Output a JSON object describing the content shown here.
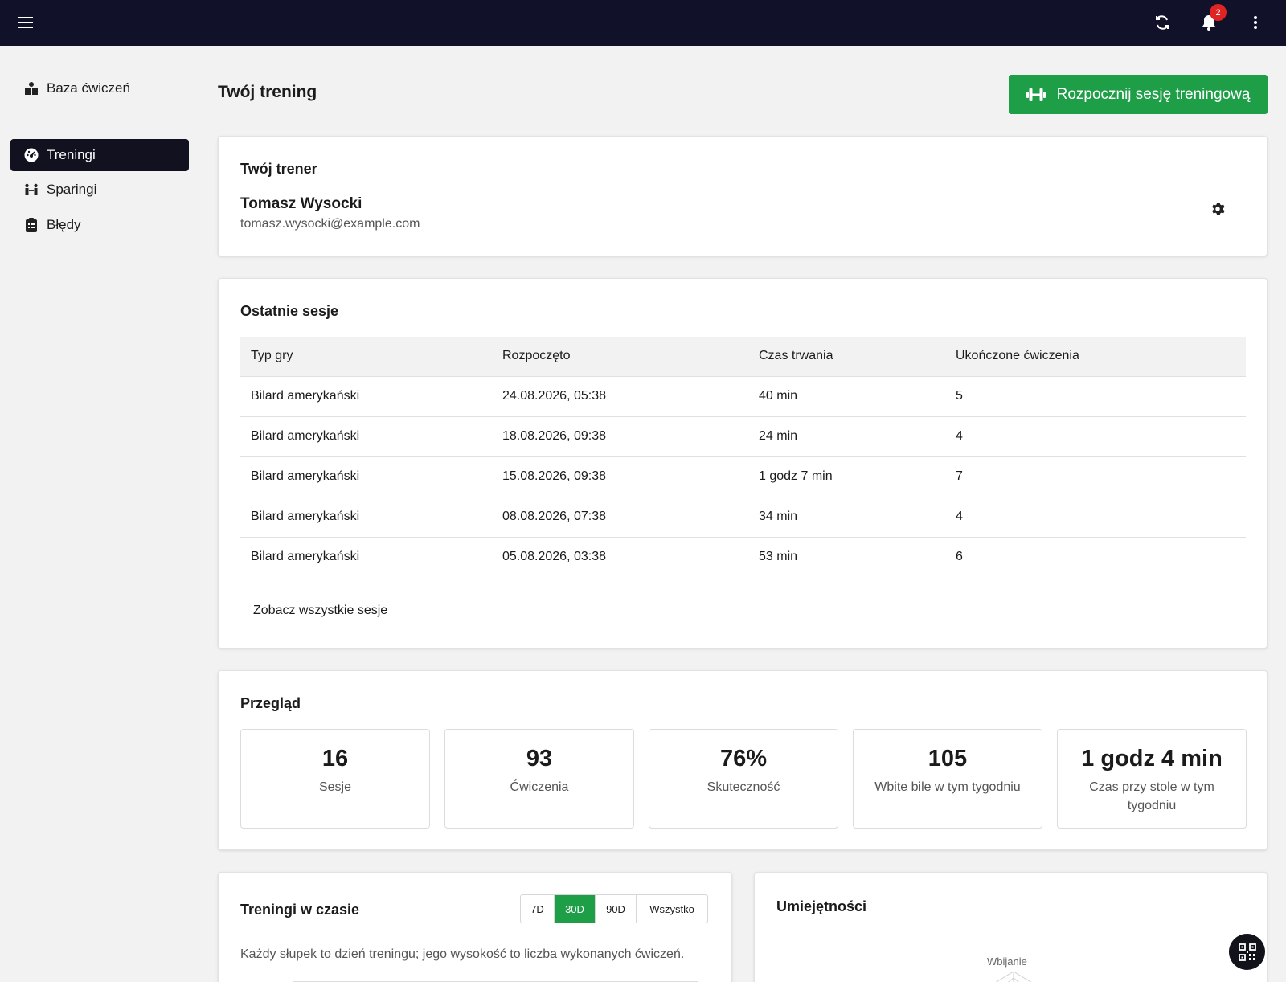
{
  "topbar": {
    "notifications_count": "2",
    "icons": [
      "menu-icon",
      "refresh-icon",
      "bell-icon",
      "more-vertical-icon"
    ]
  },
  "sidebar": {
    "items": [
      {
        "label": "Baza ćwiczeń",
        "icon": "library-icon",
        "active": false
      },
      {
        "label": "Treningi",
        "icon": "dashboard-icon",
        "active": true
      },
      {
        "label": "Sparingi",
        "icon": "sparring-icon",
        "active": false
      },
      {
        "label": "Błędy",
        "icon": "clipboard-list-icon",
        "active": false
      }
    ]
  },
  "header": {
    "title": "Twój trening",
    "start_button": "Rozpocznij sesję treningową"
  },
  "trainer": {
    "title": "Twój trener",
    "name": "Tomasz Wysocki",
    "email": "tomasz.wysocki@example.com"
  },
  "sessions": {
    "title": "Ostatnie sesje",
    "columns": [
      "Typ gry",
      "Rozpoczęto",
      "Czas trwania",
      "Ukończone ćwiczenia"
    ],
    "rows": [
      [
        "Bilard amerykański",
        "24.08.2026, 05:38",
        "40 min",
        "5"
      ],
      [
        "Bilard amerykański",
        "18.08.2026, 09:38",
        "24 min",
        "4"
      ],
      [
        "Bilard amerykański",
        "15.08.2026, 09:38",
        "1 godz 7 min",
        "7"
      ],
      [
        "Bilard amerykański",
        "08.08.2026, 07:38",
        "34 min",
        "4"
      ],
      [
        "Bilard amerykański",
        "05.08.2026, 03:38",
        "53 min",
        "6"
      ]
    ],
    "see_all": "Zobacz wszystkie sesje"
  },
  "overview": {
    "title": "Przegląd",
    "stats": [
      {
        "value": "16",
        "label": "Sesje"
      },
      {
        "value": "93",
        "label": "Ćwiczenia"
      },
      {
        "value": "76%",
        "label": "Skuteczność"
      },
      {
        "value": "105",
        "label": "Wbite bile w tym tygodniu"
      },
      {
        "value": "1 godz 4 min",
        "label": "Czas przy stole w tym tygodniu"
      }
    ]
  },
  "trainings_chart": {
    "title": "Treningi w czasie",
    "ranges": [
      "7D",
      "30D",
      "90D",
      "Wszystko"
    ],
    "selected_range": "30D",
    "description": "Każdy słupek to dzień treningu; jego wysokość to liczba wykonanych ćwiczeń."
  },
  "skills": {
    "title": "Umiejętności",
    "axis_label": "Wbijanie"
  },
  "colors": {
    "accent": "#1e9e47",
    "topbar": "#12112a",
    "badge": "#e02424"
  }
}
